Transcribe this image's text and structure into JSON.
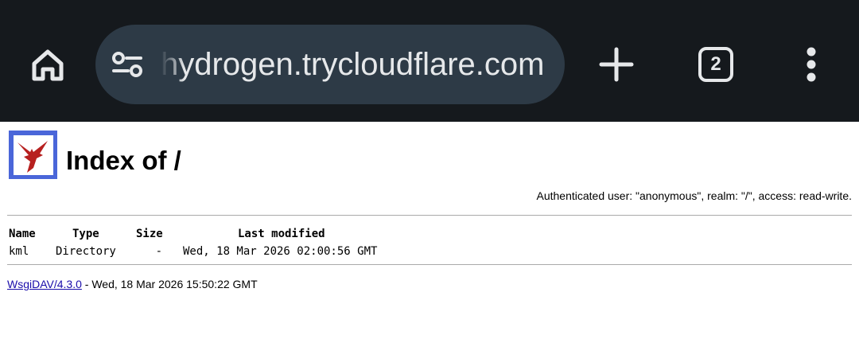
{
  "browser": {
    "url": "hydrogen.trycloudflare.com",
    "tab_count": "2",
    "icons": {
      "home": "home-icon",
      "site_info": "tune-icon",
      "new_tab": "plus-icon",
      "tabs": "tab-switcher-icon",
      "menu": "more-vert-icon"
    },
    "colors": {
      "toolbar": "#15191d",
      "omnibox": "#2d3a46"
    }
  },
  "page": {
    "title": "Index of /",
    "auth_line": "Authenticated user: \"anonymous\", realm: \"/\", access: read-write.",
    "logo_color": "#4a66d9",
    "columns": {
      "name": "Name",
      "type": "Type",
      "size": "Size",
      "modified": "Last modified"
    },
    "rows": [
      {
        "name": "kml",
        "type": "Directory",
        "size": "-",
        "modified": "Wed, 18 Mar 2026 02:00:56 GMT"
      }
    ],
    "footer": {
      "link": "WsgiDAV/4.3.0",
      "text": " - Wed, 18 Mar 2026 15:50:22 GMT"
    }
  }
}
